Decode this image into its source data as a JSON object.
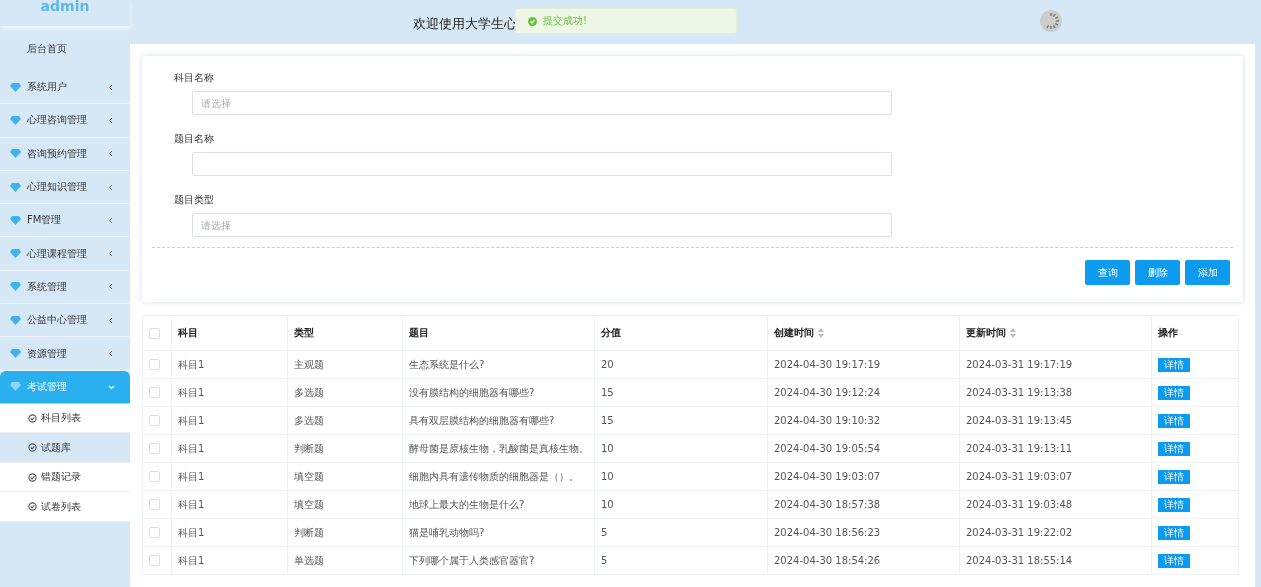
{
  "sidebar": {
    "brand": "admin",
    "home": "后台首页",
    "items": [
      {
        "label": "系统用户",
        "expanded": false
      },
      {
        "label": "心理咨询管理",
        "expanded": false
      },
      {
        "label": "咨询预约管理",
        "expanded": false
      },
      {
        "label": "心理知识管理",
        "expanded": false
      },
      {
        "label": "FM管理",
        "expanded": false
      },
      {
        "label": "心理课程管理",
        "expanded": false
      },
      {
        "label": "系统管理",
        "expanded": false
      },
      {
        "label": "公益中心管理",
        "expanded": false
      },
      {
        "label": "资源管理",
        "expanded": false
      },
      {
        "label": "考试管理",
        "expanded": true,
        "children": [
          {
            "label": "科目列表",
            "selected": false
          },
          {
            "label": "试题库",
            "selected": true
          },
          {
            "label": "错题记录",
            "selected": false
          },
          {
            "label": "试卷列表",
            "selected": false
          }
        ]
      }
    ]
  },
  "header": {
    "title": "欢迎使用大学生心",
    "toast": "提交成功!"
  },
  "form": {
    "fields": [
      {
        "label": "科目名称",
        "placeholder": "请选择"
      },
      {
        "label": "题目名称"
      },
      {
        "label": "题目类型",
        "placeholder": "请选择"
      }
    ],
    "buttons": [
      "查询",
      "删除",
      "添加"
    ]
  },
  "table": {
    "columns": [
      {
        "label": "科目",
        "sortable": false
      },
      {
        "label": "类型",
        "sortable": false
      },
      {
        "label": "题目",
        "sortable": false
      },
      {
        "label": "分值",
        "sortable": false
      },
      {
        "label": "创建时间",
        "sortable": true
      },
      {
        "label": "更新时间",
        "sortable": true
      },
      {
        "label": "操作",
        "sortable": false
      }
    ],
    "select_all": {
      "checked": false
    },
    "rows": [
      {
        "checked": false,
        "cells": [
          "科目1",
          "主观题",
          "生态系统是什么?",
          "20",
          "2024-04-30 19:17:19",
          "2024-03-31 19:17:19"
        ],
        "action": "详情"
      },
      {
        "checked": false,
        "cells": [
          "科目1",
          "多选题",
          "没有膜结构的细胞器有哪些?",
          "15",
          "2024-04-30 19:12:24",
          "2024-03-31 19:13:38"
        ],
        "action": "详情"
      },
      {
        "checked": false,
        "cells": [
          "科目1",
          "多选题",
          "具有双层膜结构的细胞器有哪些?",
          "15",
          "2024-04-30 19:10:32",
          "2024-03-31 19:13:45"
        ],
        "action": "详情"
      },
      {
        "checked": false,
        "cells": [
          "科目1",
          "判断题",
          "酵母菌是原核生物，乳酸菌是真核生物。",
          "10",
          "2024-04-30 19:05:54",
          "2024-03-31 19:13:11"
        ],
        "action": "详情"
      },
      {
        "checked": false,
        "cells": [
          "科目1",
          "填空题",
          "细胞内具有遗传物质的细胞器是（）。",
          "10",
          "2024-04-30 19:03:07",
          "2024-03-31 19:03:07"
        ],
        "action": "详情"
      },
      {
        "checked": false,
        "cells": [
          "科目1",
          "填空题",
          "地球上最大的生物是什么?",
          "10",
          "2024-04-30 18:57:38",
          "2024-03-31 19:03:48"
        ],
        "action": "详情"
      },
      {
        "checked": false,
        "cells": [
          "科目1",
          "判断题",
          "猫是哺乳动物吗?",
          "5",
          "2024-04-30 18:56:23",
          "2024-03-31 19:22:02"
        ],
        "action": "详情"
      },
      {
        "checked": false,
        "cells": [
          "科目1",
          "单选题",
          "下列哪个属于人类感官器官?",
          "5",
          "2024-04-30 18:54:26",
          "2024-03-31 18:55:14"
        ],
        "action": "详情"
      }
    ]
  }
}
